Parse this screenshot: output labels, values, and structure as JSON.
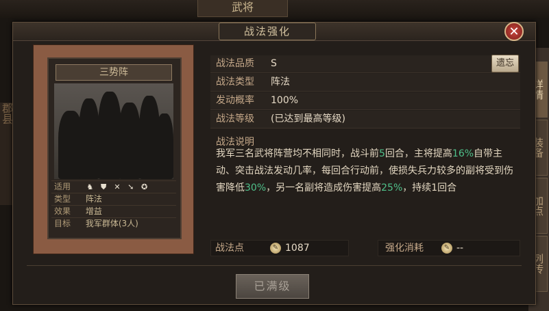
{
  "background": {
    "window_title": "武将",
    "side_tabs": [
      "详情",
      "装备",
      "加点",
      "列传"
    ],
    "left_peek_text": "郡县"
  },
  "dialog": {
    "title": "战法强化",
    "close_label": "✕"
  },
  "card": {
    "name": "三势阵",
    "props": {
      "suit_label": "适用",
      "suit_icons": [
        "cavalry-icon",
        "shield-icon",
        "bow-icon",
        "spear-icon",
        "siege-icon"
      ],
      "type_label": "类型",
      "type_value": "阵法",
      "effect_label": "效果",
      "effect_value": "增益",
      "target_label": "目标",
      "target_value": "我军群体(3人)"
    }
  },
  "info": {
    "quality_label": "战法品质",
    "quality_value": "S",
    "forget_button": "遗忘",
    "type_label": "战法类型",
    "type_value": "阵法",
    "rate_label": "发动概率",
    "rate_value": "100%",
    "level_label": "战法等级",
    "level_value": "(已达到最高等级)"
  },
  "description": {
    "heading": "战法说明",
    "parts": [
      {
        "t": "我军三名武将阵营均不相同时，战斗前",
        "hl": false
      },
      {
        "t": "5",
        "hl": true
      },
      {
        "t": "回合，主将提高",
        "hl": false
      },
      {
        "t": "16%",
        "hl": true
      },
      {
        "t": "自带主动、突击战法发动几率，每回合行动前，使损失兵力较多的副将受到伤害降低",
        "hl": false
      },
      {
        "t": "30%",
        "hl": true
      },
      {
        "t": "，另一名副将造成伤害提高",
        "hl": false
      },
      {
        "t": "25%",
        "hl": true
      },
      {
        "t": "，持续1回合",
        "hl": false
      }
    ]
  },
  "points": {
    "label": "战法点",
    "value": "1087"
  },
  "cost": {
    "label": "强化消耗",
    "value": "--"
  },
  "action": {
    "maxed_label": "已满级"
  },
  "colors": {
    "highlight": "#4fc08a",
    "panel_bg": "#231e1a",
    "scroll_border": "#8a5b43"
  }
}
